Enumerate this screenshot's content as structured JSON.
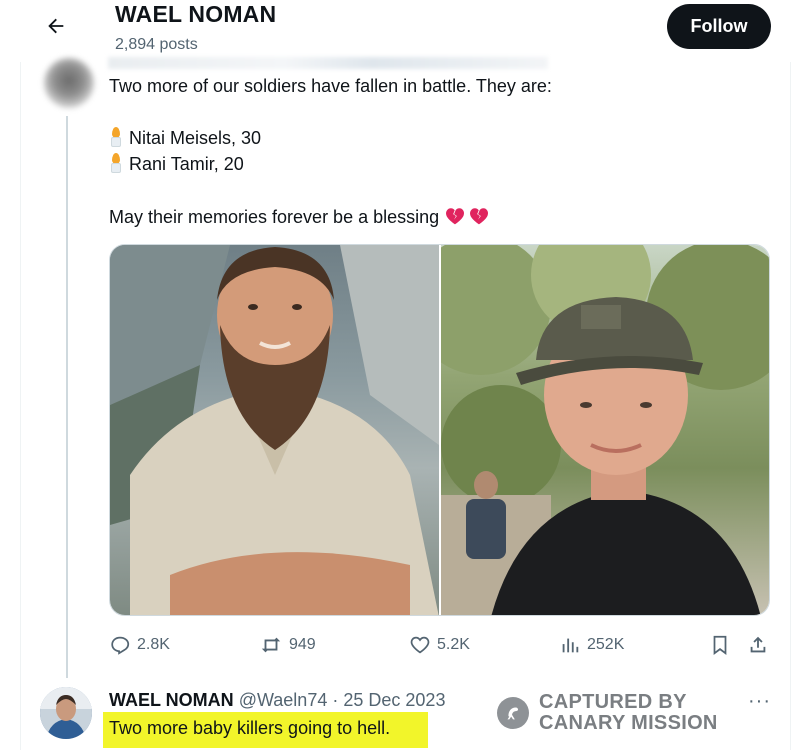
{
  "header": {
    "name": "WAEL NOMAN",
    "posts": "2,894 posts",
    "follow_label": "Follow"
  },
  "tweet": {
    "line1": "Two more of our soldiers have fallen in battle. They are:",
    "names": [
      "Nitai Meisels, 30",
      "Rani Tamir, 20"
    ],
    "blessing": "May their memories forever be a blessing",
    "emoji": [
      "candle",
      "broken-heart"
    ],
    "media": [
      {
        "description_icon": "photo-bearded-man-icon"
      },
      {
        "description_icon": "photo-man-in-cap-icon"
      }
    ],
    "actions": {
      "replies": "2.8K",
      "reposts": "949",
      "likes": "5.2K",
      "views": "252K"
    }
  },
  "reply": {
    "name": "WAEL NOMAN",
    "handle": "@Waeln74",
    "separator": "·",
    "date": "25 Dec 2023",
    "text": "Two more baby killers going to hell.",
    "more": "···"
  },
  "watermark": {
    "line1": "CAPTURED BY",
    "line2": "CANARY MISSION"
  },
  "colors": {
    "text": "#0f1419",
    "secondary": "#536471",
    "highlight": "#f2f52a",
    "button_bg": "#0f1419",
    "heart": "#e0245e"
  }
}
